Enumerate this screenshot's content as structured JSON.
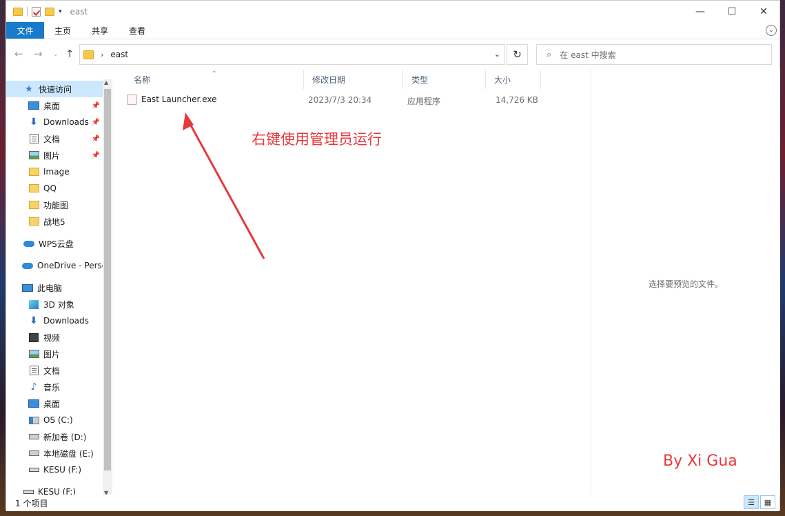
{
  "window": {
    "title": "east",
    "controls": {
      "minimize": "—",
      "maximize": "☐",
      "close": "✕"
    }
  },
  "ribbon": {
    "tabs": [
      "文件",
      "主页",
      "共享",
      "查看"
    ],
    "expand_icon": "chevron-down-icon"
  },
  "address": {
    "path": "east",
    "separator": "›",
    "search_placeholder": "在 east 中搜索"
  },
  "nav": {
    "quick_access": "快速访问",
    "quick_items": [
      {
        "label": "桌面",
        "icon": "desktop-icon",
        "pinned": true
      },
      {
        "label": "Downloads",
        "icon": "download-icon",
        "pinned": true
      },
      {
        "label": "文档",
        "icon": "document-icon",
        "pinned": true
      },
      {
        "label": "图片",
        "icon": "picture-icon",
        "pinned": true
      },
      {
        "label": "Image",
        "icon": "folder-icon",
        "pinned": false
      },
      {
        "label": "QQ",
        "icon": "folder-icon",
        "pinned": false
      },
      {
        "label": "功能图",
        "icon": "folder-icon",
        "pinned": false
      },
      {
        "label": "战地5",
        "icon": "folder-icon",
        "pinned": false
      }
    ],
    "wps": "WPS云盘",
    "onedrive": "OneDrive - Perso",
    "this_pc": "此电脑",
    "pc_items": [
      {
        "label": "3D 对象",
        "icon": "3d-objects-icon"
      },
      {
        "label": "Downloads",
        "icon": "download-icon"
      },
      {
        "label": "视频",
        "icon": "video-icon"
      },
      {
        "label": "图片",
        "icon": "picture-icon"
      },
      {
        "label": "文档",
        "icon": "document-icon"
      },
      {
        "label": "音乐",
        "icon": "music-icon"
      },
      {
        "label": "桌面",
        "icon": "desktop-icon"
      },
      {
        "label": "OS (C:)",
        "icon": "os-drive-icon"
      },
      {
        "label": "新加卷 (D:)",
        "icon": "drive-icon"
      },
      {
        "label": "本地磁盘 (E:)",
        "icon": "drive-icon"
      },
      {
        "label": "KESU (F:)",
        "icon": "usb-drive-icon"
      }
    ],
    "extra_drive": "KESU (F:)"
  },
  "columns": {
    "name": "名称",
    "modified": "修改日期",
    "type": "类型",
    "size": "大小"
  },
  "files": [
    {
      "name": "East Launcher.exe",
      "modified": "2023/7/3 20:34",
      "type": "应用程序",
      "size": "14,726 KB"
    }
  ],
  "annotation": "右键使用管理员运行",
  "preview_text": "选择要预览的文件。",
  "byline": "By Xi Gua",
  "status": {
    "count": "1 个项目"
  },
  "colors": {
    "accent": "#1979ca",
    "selection": "#cce8ff",
    "annotation": "#e8383d"
  }
}
